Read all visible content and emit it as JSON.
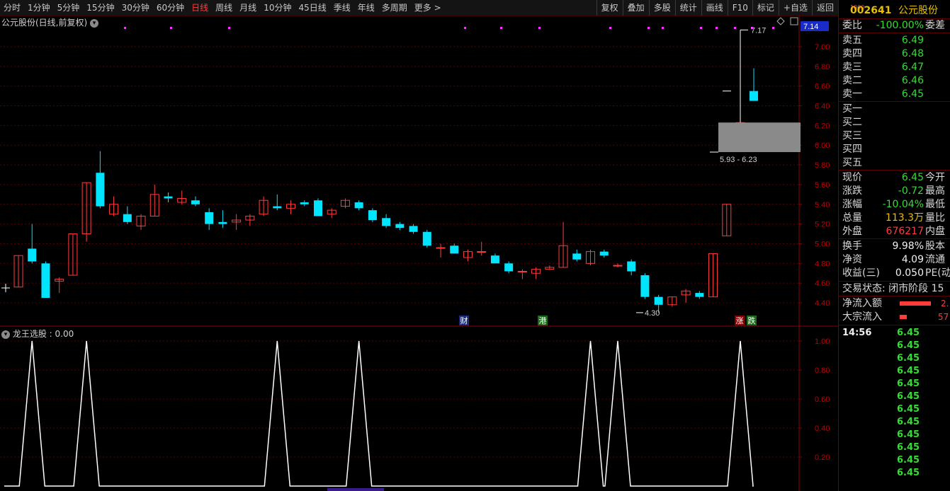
{
  "toolbar": {
    "periods": [
      "分时",
      "1分钟",
      "5分钟",
      "15分钟",
      "30分钟",
      "60分钟",
      "日线",
      "周线",
      "月线",
      "10分钟",
      "45日线",
      "季线",
      "年线",
      "多周期",
      "更多 >"
    ],
    "active_period": "日线",
    "tools": [
      "复权",
      "叠加",
      "多股",
      "统计",
      "画线",
      "F10",
      "标记",
      "+自选",
      "返回"
    ]
  },
  "chart": {
    "title": "公元股份(日线,前复权)",
    "price_ticks": [
      "7.00",
      "6.80",
      "6.60",
      "6.40",
      "6.20",
      "6.00",
      "5.80",
      "5.60",
      "5.40",
      "5.20",
      "5.00",
      "4.80",
      "4.60",
      "4.40"
    ],
    "current_price_tag": "7.14",
    "high_annotation": "7.17",
    "low_annotation": "4.30",
    "range_annotation": "5.93 - 6.23",
    "markers": {
      "cai": "财",
      "gang": "港",
      "zhang": "涨",
      "die": "跌"
    }
  },
  "indicator": {
    "title": "龙王选股 : 0.00",
    "ticks": [
      "1.00",
      "0.80",
      "0.60",
      "0.40",
      "0.20"
    ]
  },
  "colors": {
    "up": "#ff3c3c",
    "down": "#00e5ff",
    "grid": "#5a0000",
    "green": "#33dd33",
    "yellow": "#e8c000"
  },
  "panel": {
    "code_prefix": "1000",
    "code": "002641",
    "name": "公元股份",
    "weibi_label": "委比",
    "weibi": "-100.00%",
    "weicha_label": "委差",
    "sells": [
      {
        "label": "卖五",
        "price": "6.49"
      },
      {
        "label": "卖四",
        "price": "6.48"
      },
      {
        "label": "卖三",
        "price": "6.47"
      },
      {
        "label": "卖二",
        "price": "6.46"
      },
      {
        "label": "卖一",
        "price": "6.45"
      }
    ],
    "buys": [
      {
        "label": "买一"
      },
      {
        "label": "买二"
      },
      {
        "label": "买三"
      },
      {
        "label": "买四"
      },
      {
        "label": "买五"
      }
    ],
    "stats": [
      {
        "label": "现价",
        "value": "6.45",
        "color": "green",
        "label2": "今开"
      },
      {
        "label": "涨跌",
        "value": "-0.72",
        "color": "green",
        "label2": "最高"
      },
      {
        "label": "涨幅",
        "value": "-10.04%",
        "color": "green",
        "label2": "最低"
      },
      {
        "label": "总量",
        "value": "113.3万",
        "color": "yellow",
        "label2": "量比"
      },
      {
        "label": "外盘",
        "value": "676217",
        "color": "red",
        "label2": "内盘"
      }
    ],
    "stats2": [
      {
        "label": "换手",
        "value": "9.98%",
        "color": "white",
        "label2": "股本"
      },
      {
        "label": "净资",
        "value": "4.09",
        "color": "white",
        "label2": "流通"
      },
      {
        "label": "收益(三)",
        "value": "0.050",
        "color": "white",
        "label2": "PE(动"
      }
    ],
    "trade_status": "交易状态: 闭市阶段 15",
    "net_inflow_label": "净流入额",
    "net_inflow_value": "2.",
    "block_inflow_label": "大宗流入",
    "block_inflow_value": "57",
    "ticks_time": "14:56",
    "ticks": [
      "6.45",
      "6.45",
      "6.45",
      "6.45",
      "6.45",
      "6.45",
      "6.45",
      "6.45",
      "6.45",
      "6.45",
      "6.45",
      "6.45"
    ]
  },
  "chart_data": {
    "type": "candlestick",
    "y_range": [
      4.2,
      7.2
    ],
    "candles": [
      {
        "o": 4.56,
        "c": 4.88,
        "h": 4.88,
        "l": 4.56
      },
      {
        "o": 4.95,
        "c": 4.82,
        "h": 5.2,
        "l": 4.8
      },
      {
        "o": 4.8,
        "c": 4.45,
        "h": 4.82,
        "l": 4.45
      },
      {
        "o": 4.62,
        "c": 4.64,
        "h": 4.66,
        "l": 4.5
      },
      {
        "o": 4.68,
        "c": 5.1,
        "h": 5.1,
        "l": 4.68
      },
      {
        "o": 5.1,
        "c": 5.62,
        "h": 5.62,
        "l": 5.02
      },
      {
        "o": 5.72,
        "c": 5.38,
        "h": 5.94,
        "l": 5.36
      },
      {
        "o": 5.3,
        "c": 5.4,
        "h": 5.48,
        "l": 5.28
      },
      {
        "o": 5.3,
        "c": 5.22,
        "h": 5.38,
        "l": 5.2
      },
      {
        "o": 5.18,
        "c": 5.28,
        "h": 5.3,
        "l": 5.14
      },
      {
        "o": 5.28,
        "c": 5.5,
        "h": 5.6,
        "l": 5.28
      },
      {
        "o": 5.48,
        "c": 5.46,
        "h": 5.52,
        "l": 5.42
      },
      {
        "o": 5.42,
        "c": 5.46,
        "h": 5.54,
        "l": 5.4
      },
      {
        "o": 5.44,
        "c": 5.4,
        "h": 5.48,
        "l": 5.38
      },
      {
        "o": 5.32,
        "c": 5.2,
        "h": 5.36,
        "l": 5.14
      },
      {
        "o": 5.22,
        "c": 5.2,
        "h": 5.34,
        "l": 5.16
      },
      {
        "o": 5.22,
        "c": 5.24,
        "h": 5.3,
        "l": 5.14
      },
      {
        "o": 5.24,
        "c": 5.28,
        "h": 5.3,
        "l": 5.18
      },
      {
        "o": 5.3,
        "c": 5.44,
        "h": 5.48,
        "l": 5.28
      },
      {
        "o": 5.38,
        "c": 5.36,
        "h": 5.5,
        "l": 5.34
      },
      {
        "o": 5.36,
        "c": 5.4,
        "h": 5.44,
        "l": 5.3
      },
      {
        "o": 5.42,
        "c": 5.4,
        "h": 5.44,
        "l": 5.38
      },
      {
        "o": 5.44,
        "c": 5.28,
        "h": 5.46,
        "l": 5.28
      },
      {
        "o": 5.3,
        "c": 5.34,
        "h": 5.36,
        "l": 5.26
      },
      {
        "o": 5.38,
        "c": 5.44,
        "h": 5.46,
        "l": 5.36
      },
      {
        "o": 5.42,
        "c": 5.36,
        "h": 5.44,
        "l": 5.34
      },
      {
        "o": 5.34,
        "c": 5.24,
        "h": 5.36,
        "l": 5.22
      },
      {
        "o": 5.26,
        "c": 5.18,
        "h": 5.3,
        "l": 5.16
      },
      {
        "o": 5.2,
        "c": 5.16,
        "h": 5.22,
        "l": 5.14
      },
      {
        "o": 5.18,
        "c": 5.12,
        "h": 5.2,
        "l": 5.1
      },
      {
        "o": 5.12,
        "c": 4.98,
        "h": 5.14,
        "l": 4.96
      },
      {
        "o": 4.96,
        "c": 4.96,
        "h": 5.0,
        "l": 4.86
      },
      {
        "o": 4.98,
        "c": 4.9,
        "h": 5.0,
        "l": 4.9
      },
      {
        "o": 4.86,
        "c": 4.92,
        "h": 4.94,
        "l": 4.82
      },
      {
        "o": 4.92,
        "c": 4.92,
        "h": 5.02,
        "l": 4.88
      },
      {
        "o": 4.88,
        "c": 4.8,
        "h": 4.9,
        "l": 4.8
      },
      {
        "o": 4.8,
        "c": 4.72,
        "h": 4.82,
        "l": 4.7
      },
      {
        "o": 4.72,
        "c": 4.72,
        "h": 4.74,
        "l": 4.64
      },
      {
        "o": 4.7,
        "c": 4.74,
        "h": 4.76,
        "l": 4.64
      },
      {
        "o": 4.74,
        "c": 4.76,
        "h": 4.78,
        "l": 4.74
      },
      {
        "o": 4.76,
        "c": 4.98,
        "h": 5.22,
        "l": 4.76
      },
      {
        "o": 4.9,
        "c": 4.84,
        "h": 4.94,
        "l": 4.82
      },
      {
        "o": 4.8,
        "c": 4.92,
        "h": 4.94,
        "l": 4.78
      },
      {
        "o": 4.92,
        "c": 4.88,
        "h": 4.94,
        "l": 4.86
      },
      {
        "o": 4.78,
        "c": 4.78,
        "h": 4.8,
        "l": 4.76
      },
      {
        "o": 4.82,
        "c": 4.72,
        "h": 4.84,
        "l": 4.68
      },
      {
        "o": 4.68,
        "c": 4.46,
        "h": 4.7,
        "l": 4.44
      },
      {
        "o": 4.46,
        "c": 4.38,
        "h": 4.48,
        "l": 4.3
      },
      {
        "o": 4.38,
        "c": 4.46,
        "h": 4.46,
        "l": 4.36
      },
      {
        "o": 4.48,
        "c": 4.52,
        "h": 4.54,
        "l": 4.4
      },
      {
        "o": 4.5,
        "c": 4.46,
        "h": 4.52,
        "l": 4.44
      },
      {
        "o": 4.46,
        "c": 4.9,
        "h": 4.9,
        "l": 4.46
      },
      {
        "o": 5.08,
        "c": 5.4,
        "h": 5.4,
        "l": 5.08
      },
      {
        "o": 6.23,
        "c": 6.23,
        "h": 7.17,
        "l": 6.23,
        "spike": true
      },
      {
        "o": 6.55,
        "c": 6.45,
        "h": 6.78,
        "l": 6.45
      }
    ],
    "indicator_series": {
      "name": "龙王选股",
      "range": [
        0,
        1
      ],
      "peak_indices": [
        1,
        5,
        19,
        25,
        42,
        44,
        53
      ]
    }
  }
}
